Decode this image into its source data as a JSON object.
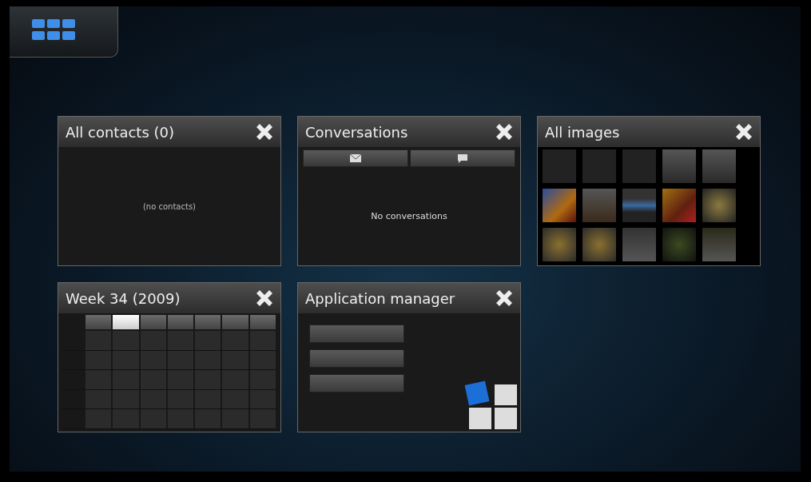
{
  "cards": [
    {
      "kind": "contacts",
      "title": "All contacts (0)",
      "message": "(no contacts)"
    },
    {
      "kind": "conversations",
      "title": "Conversations",
      "message": "No conversations"
    },
    {
      "kind": "images",
      "title": "All images"
    },
    {
      "kind": "calendar",
      "title": "Week 34 (2009)",
      "days": [
        {
          "selected": false
        },
        {
          "selected": true
        },
        {
          "selected": false
        },
        {
          "selected": false
        },
        {
          "selected": false
        },
        {
          "selected": false
        },
        {
          "selected": false
        }
      ]
    },
    {
      "kind": "appmanager",
      "title": "Application manager"
    }
  ]
}
